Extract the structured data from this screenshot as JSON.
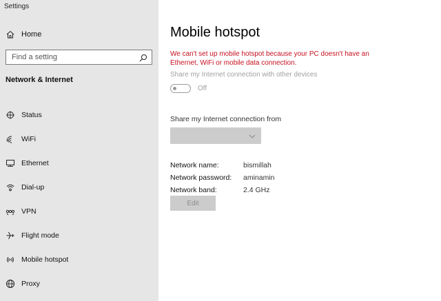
{
  "window": {
    "title": "Settings"
  },
  "sidebar": {
    "home_label": "Home",
    "search_placeholder": "Find a setting",
    "section_title": "Network & Internet",
    "items": [
      {
        "label": "Status",
        "icon": "status-icon"
      },
      {
        "label": "WiFi",
        "icon": "wifi-icon"
      },
      {
        "label": "Ethernet",
        "icon": "ethernet-icon"
      },
      {
        "label": "Dial-up",
        "icon": "dialup-icon"
      },
      {
        "label": "VPN",
        "icon": "vpn-icon"
      },
      {
        "label": "Flight mode",
        "icon": "airplane-icon"
      },
      {
        "label": "Mobile hotspot",
        "icon": "hotspot-icon"
      },
      {
        "label": "Proxy",
        "icon": "globe-icon"
      }
    ]
  },
  "main": {
    "title": "Mobile hotspot",
    "error": "We can't set up mobile hotspot because your PC doesn't have an Ethernet, WiFi or mobile data connection.",
    "share_label": "Share my Internet connection with other devices",
    "toggle_state": "Off",
    "share_from_label": "Share my Internet connection from",
    "dropdown_value": "",
    "network_name_label": "Network name:",
    "network_name": "bismillah",
    "network_password_label": "Network password:",
    "network_password": "aminamin",
    "network_band_label": "Network band:",
    "network_band": "2.4 GHz",
    "edit_label": "Edit"
  },
  "colors": {
    "sidebar_bg": "#e6e6e6",
    "error": "#c50f1f",
    "disabled_text": "#a0a0a0",
    "disabled_fill": "#cccccc"
  }
}
